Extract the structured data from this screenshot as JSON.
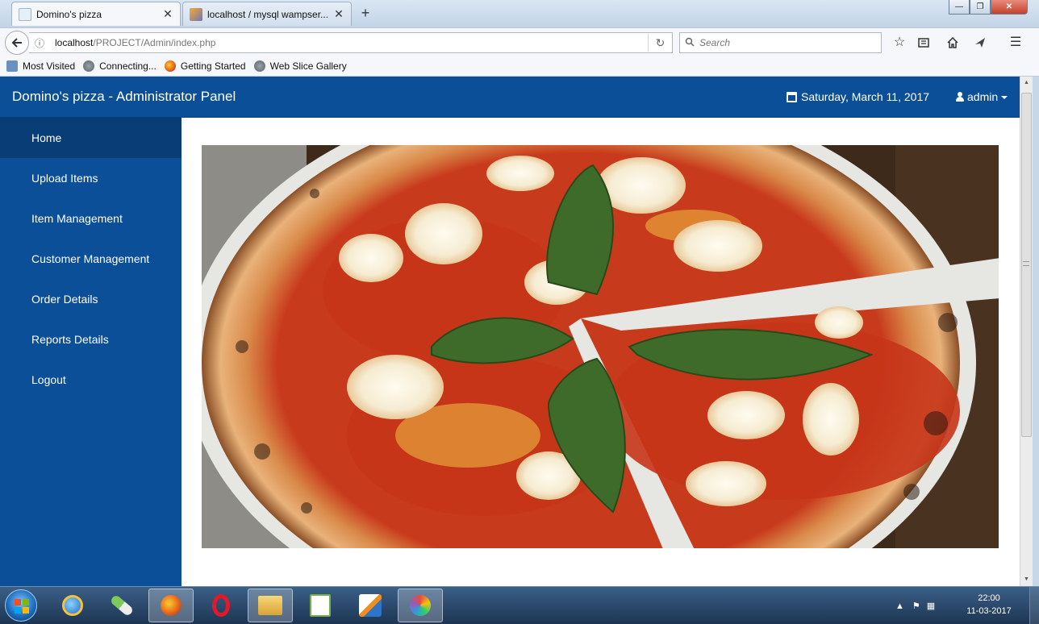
{
  "browser": {
    "tabs": [
      {
        "title": "Domino's pizza",
        "close": "✕",
        "active": true
      },
      {
        "title": "localhost / mysql wampser...",
        "close": "✕",
        "active": false
      }
    ],
    "new_tab": "+",
    "window_controls": {
      "minimize": "—",
      "maximize": "❐",
      "close": "✕"
    },
    "url": {
      "host": "localhost",
      "path": "/PROJECT/Admin/index.php"
    },
    "search_placeholder": "Search",
    "bookmarks": [
      "Most Visited",
      "Connecting...",
      "Getting Started",
      "Web Slice Gallery"
    ],
    "icons": {
      "back": "back-arrow-icon",
      "info": "info-icon",
      "reload": "reload-icon",
      "search": "search-icon",
      "bookmark_star": "star-icon",
      "reading_list": "library-icon",
      "home": "home-icon",
      "pocket": "send-icon",
      "menu": "hamburger-menu-icon"
    }
  },
  "app": {
    "brand": "Domino's pizza - Administrator Panel",
    "date": "Saturday, March 11, 2017",
    "user": "admin",
    "accent_color": "#0a4f97",
    "active_color": "#093d75",
    "sidebar": [
      {
        "label": "Home",
        "active": true
      },
      {
        "label": "Upload Items",
        "active": false
      },
      {
        "label": "Item Management",
        "active": false
      },
      {
        "label": "Customer Management",
        "active": false
      },
      {
        "label": "Order Details",
        "active": false
      },
      {
        "label": "Reports Details",
        "active": false
      },
      {
        "label": "Logout",
        "active": false
      }
    ],
    "hero_image": "margherita-pizza-photo"
  },
  "taskbar": {
    "apps": [
      "internet-explorer-icon",
      "pill-app-icon",
      "firefox-icon",
      "opera-icon",
      "file-explorer-icon",
      "notepad-plus-icon",
      "sublime-app-icon",
      "paint-icon"
    ],
    "time": "22:00",
    "date": "11-03-2017"
  }
}
